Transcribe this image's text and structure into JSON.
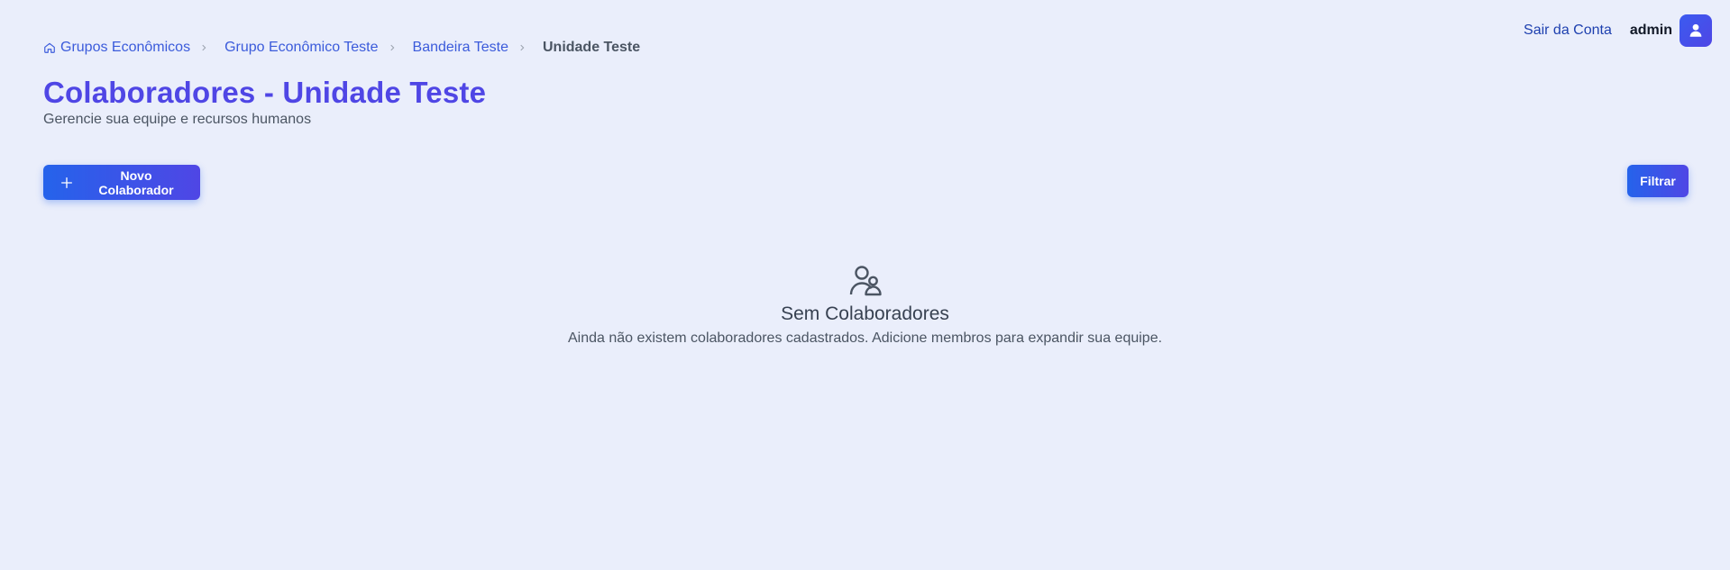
{
  "account": {
    "logout_label": "Sair da Conta",
    "username": "admin",
    "avatar_icon": "user-icon"
  },
  "breadcrumb": {
    "items": [
      {
        "label": "Grupos Econômicos",
        "icon": "home-icon"
      },
      {
        "label": "Grupo Econômico Teste"
      },
      {
        "label": "Bandeira Teste"
      }
    ],
    "current": "Unidade Teste"
  },
  "header": {
    "title": "Colaboradores - Unidade Teste",
    "subtitle": "Gerencie sua equipe e recursos humanos"
  },
  "toolbar": {
    "new_label": "Novo Colaborador",
    "new_icon": "plus-icon",
    "filter_label": "Filtrar"
  },
  "empty_state": {
    "icon": "users-icon",
    "title": "Sem Colaboradores",
    "description": "Ainda não existem colaboradores cadastrados. Adicione membros para expandir sua equipe."
  },
  "colors": {
    "background": "#eaeefb",
    "accent": "#4f46e5",
    "link": "#3b5bdb",
    "button_gradient_start": "#2563eb"
  }
}
